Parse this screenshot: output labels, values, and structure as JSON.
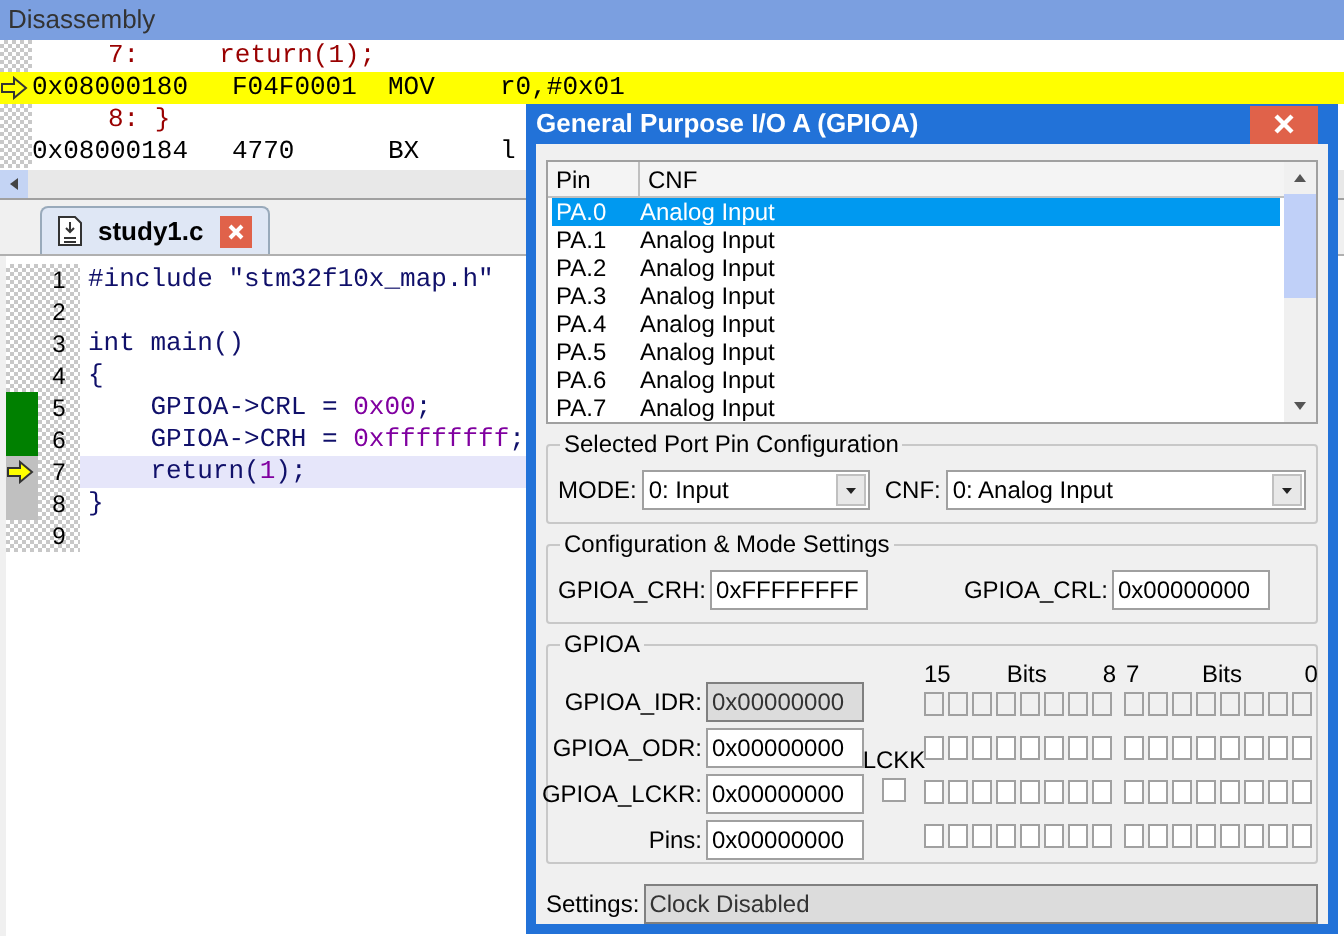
{
  "disassembly": {
    "title": "Disassembly",
    "rows": [
      {
        "kind": "source",
        "current": false,
        "cells": [
          "7:",
          "return(1);"
        ]
      },
      {
        "kind": "instruction",
        "current": true,
        "cells": [
          "0x08000180",
          "F04F0001",
          "MOV",
          "r0,#0x01"
        ]
      },
      {
        "kind": "source",
        "current": false,
        "cells": [
          "8: }"
        ]
      },
      {
        "kind": "instruction",
        "current": false,
        "cells": [
          "0x08000184",
          "4770",
          "BX",
          "l"
        ]
      }
    ]
  },
  "editor": {
    "tab": {
      "label": "study1.c",
      "selected": true
    },
    "lines": [
      {
        "number": "1",
        "has_code": false,
        "current": false,
        "tokens": [
          {
            "kind": "plain",
            "text": "#include \"stm32f10x_map.h\""
          }
        ]
      },
      {
        "number": "2",
        "has_code": false,
        "current": false
      },
      {
        "number": "3",
        "has_code": false,
        "current": false,
        "tokens": [
          {
            "kind": "plain",
            "text": "int main()"
          }
        ]
      },
      {
        "number": "4",
        "has_code": false,
        "current": false,
        "tokens": [
          {
            "kind": "plain",
            "text": "{"
          }
        ]
      },
      {
        "number": "5",
        "has_code": true,
        "executed": true,
        "current": false,
        "tokens": [
          {
            "kind": "plain",
            "text": "    GPIOA->CRL = "
          },
          {
            "kind": "number",
            "text": "0x00"
          },
          {
            "kind": "plain",
            "text": ";"
          }
        ]
      },
      {
        "number": "6",
        "has_code": true,
        "executed": true,
        "current": false,
        "tokens": [
          {
            "kind": "plain",
            "text": "    GPIOA->CRH = "
          },
          {
            "kind": "number",
            "text": "0xffffffff"
          },
          {
            "kind": "plain",
            "text": ";"
          }
        ]
      },
      {
        "number": "7",
        "has_code": true,
        "executed": false,
        "current": true,
        "tokens": [
          {
            "kind": "plain",
            "text": "    return("
          },
          {
            "kind": "number",
            "text": "1"
          },
          {
            "kind": "plain",
            "text": ");"
          }
        ]
      },
      {
        "number": "8",
        "has_code": true,
        "executed": false,
        "current": false,
        "tokens": [
          {
            "kind": "plain",
            "text": "}"
          }
        ]
      },
      {
        "number": "9",
        "has_code": false,
        "current": false
      }
    ]
  },
  "dialog": {
    "title": "General Purpose I/O A (GPIOA)",
    "pin_table": {
      "columns": [
        "Pin",
        "CNF"
      ],
      "rows": [
        {
          "pin": "PA.0",
          "cnf": "Analog Input",
          "selected": true
        },
        {
          "pin": "PA.1",
          "cnf": "Analog Input",
          "selected": false
        },
        {
          "pin": "PA.2",
          "cnf": "Analog Input",
          "selected": false
        },
        {
          "pin": "PA.3",
          "cnf": "Analog Input",
          "selected": false
        },
        {
          "pin": "PA.4",
          "cnf": "Analog Input",
          "selected": false
        },
        {
          "pin": "PA.5",
          "cnf": "Analog Input",
          "selected": false
        },
        {
          "pin": "PA.6",
          "cnf": "Analog Input",
          "selected": false
        },
        {
          "pin": "PA.7",
          "cnf": "Analog Input",
          "selected": false
        }
      ]
    },
    "port_pin_config": {
      "title": "Selected Port Pin Configuration",
      "mode_label": "MODE:",
      "mode_value": "0: Input",
      "cnf_label": "CNF:",
      "cnf_value": "0: Analog Input"
    },
    "mode_settings": {
      "title": "Configuration & Mode Settings",
      "crh_label": "GPIOA_CRH:",
      "crh_value": "0xFFFFFFFF",
      "crl_label": "GPIOA_CRL:",
      "crl_value": "0x00000000"
    },
    "gpioa": {
      "title": "GPIOA",
      "bits_high": [
        "15",
        "Bits",
        "8"
      ],
      "bits_low": [
        "7",
        "Bits",
        "0"
      ],
      "lckk_label": "LCKK",
      "lckk_checked": false,
      "registers": [
        {
          "label": "GPIOA_IDR:",
          "value": "0x00000000",
          "disabled": true,
          "bits": [
            false,
            false,
            false,
            false,
            false,
            false,
            false,
            false,
            false,
            false,
            false,
            false,
            false,
            false,
            false,
            false
          ]
        },
        {
          "label": "GPIOA_ODR:",
          "value": "0x00000000",
          "disabled": false,
          "bits": [
            false,
            false,
            false,
            false,
            false,
            false,
            false,
            false,
            false,
            false,
            false,
            false,
            false,
            false,
            false,
            false
          ]
        },
        {
          "label": "GPIOA_LCKR:",
          "value": "0x00000000",
          "disabled": false,
          "bits": [
            false,
            false,
            false,
            false,
            false,
            false,
            false,
            false,
            false,
            false,
            false,
            false,
            false,
            false,
            false,
            false
          ]
        },
        {
          "label": "Pins:",
          "value": "0x00000000",
          "disabled": false,
          "bits": [
            false,
            false,
            false,
            false,
            false,
            false,
            false,
            false,
            false,
            false,
            false,
            false,
            false,
            false,
            false,
            false
          ]
        }
      ]
    },
    "settings_label": "Settings:",
    "settings_value": "Clock Disabled"
  }
}
